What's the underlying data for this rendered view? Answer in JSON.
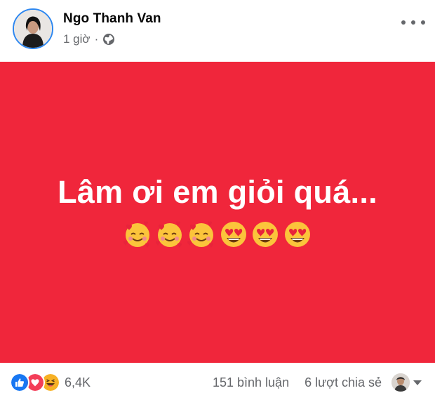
{
  "post": {
    "author": "Ngo Thanh Van",
    "time": "1 giờ",
    "separator": "·",
    "privacy_icon": "globe-icon",
    "more_icon": "more-options-icon",
    "background_color": "#f0263b",
    "text": "Lâm ơi em giỏi quá...",
    "emojis": [
      "smiling-face-with-hearts",
      "smiling-face-with-hearts",
      "smiling-face-with-hearts",
      "heart-eyes",
      "heart-eyes",
      "heart-eyes"
    ]
  },
  "footer": {
    "reaction_icons": [
      "like-icon",
      "love-icon",
      "haha-icon"
    ],
    "reaction_count": "6,4K",
    "comments": "151 bình luận",
    "shares": "6 lượt chia sẻ"
  },
  "colors": {
    "accent_blue": "#2d87f0",
    "like_blue": "#1877f2",
    "love_red": "#f33e58",
    "haha_yellow": "#f7b125",
    "secondary_text": "#65676b"
  }
}
